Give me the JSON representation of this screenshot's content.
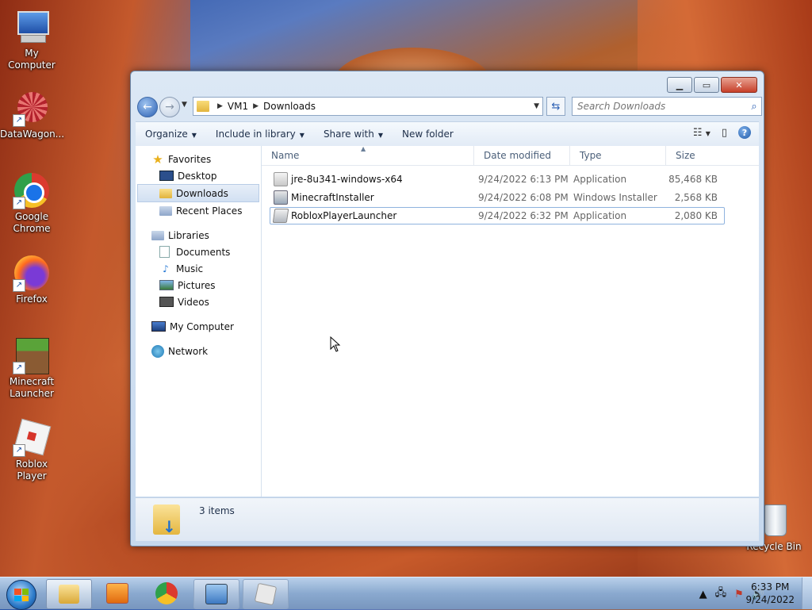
{
  "desktop": {
    "icons": [
      {
        "label": "My Computer"
      },
      {
        "label": "DataWagon..."
      },
      {
        "label": "Google Chrome"
      },
      {
        "label": "Firefox"
      },
      {
        "label": "Minecraft Launcher"
      },
      {
        "label": "Roblox Player"
      },
      {
        "label": "Recycle Bin"
      }
    ]
  },
  "window": {
    "address": {
      "crumbs": [
        "VM1",
        "Downloads"
      ]
    },
    "search": {
      "placeholder": "Search Downloads"
    },
    "toolbar": {
      "organize": "Organize",
      "include": "Include in library",
      "share": "Share with",
      "new_folder": "New folder"
    },
    "nav": {
      "favorites": "Favorites",
      "desktop": "Desktop",
      "downloads": "Downloads",
      "recent": "Recent Places",
      "libraries": "Libraries",
      "documents": "Documents",
      "music": "Music",
      "pictures": "Pictures",
      "videos": "Videos",
      "computer": "My Computer",
      "network": "Network"
    },
    "columns": {
      "name": "Name",
      "date": "Date modified",
      "type": "Type",
      "size": "Size"
    },
    "files": [
      {
        "name": "jre-8u341-windows-x64",
        "date": "9/24/2022 6:13 PM",
        "type": "Application",
        "size": "85,468 KB"
      },
      {
        "name": "MinecraftInstaller",
        "date": "9/24/2022 6:08 PM",
        "type": "Windows Installer ...",
        "size": "2,568 KB"
      },
      {
        "name": "RobloxPlayerLauncher",
        "date": "9/24/2022 6:32 PM",
        "type": "Application",
        "size": "2,080 KB"
      }
    ],
    "status": "3 items"
  },
  "taskbar": {
    "clock_time": "6:33 PM",
    "clock_date": "9/24/2022"
  },
  "colors": {
    "accent": "#2a5fb3",
    "selection": "#d2e0f2"
  }
}
